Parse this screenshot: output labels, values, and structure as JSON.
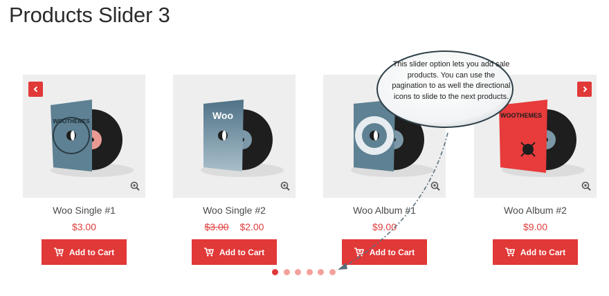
{
  "page": {
    "title": "Products Slider 3"
  },
  "slider": {
    "prev_label": "previous",
    "next_label": "next",
    "pagination": {
      "count": 6,
      "active_index": 0
    }
  },
  "products": [
    {
      "name": "Woo Single #1",
      "price": "$3.00",
      "old_price": "",
      "button": "Add to Cart",
      "cover_color": "#5e8193"
    },
    {
      "name": "Woo Single #2",
      "price": "$2.00",
      "old_price": "$3.00",
      "button": "Add to Cart",
      "cover_color": "#6c8da0"
    },
    {
      "name": "Woo Album #1",
      "price": "$9.00",
      "old_price": "",
      "button": "Add to Cart",
      "cover_color": "#5e8193"
    },
    {
      "name": "Woo Album #2",
      "price": "$9.00",
      "old_price": "",
      "button": "Add to Cart",
      "cover_color": "#e83b3b"
    }
  ],
  "tooltip": {
    "text": "This slider option lets you add sale products. You can use the pagination to as well the directional icons to slide to the next products."
  },
  "colors": {
    "accent": "#e13838",
    "dot_inactive": "#f4a19b",
    "thumb_bg": "#eeeeee",
    "price": "#e13c3c"
  },
  "icons": {
    "cart": "cart-icon",
    "zoom": "zoom-in-icon",
    "prev": "chevron-left-icon",
    "next": "chevron-right-icon"
  }
}
